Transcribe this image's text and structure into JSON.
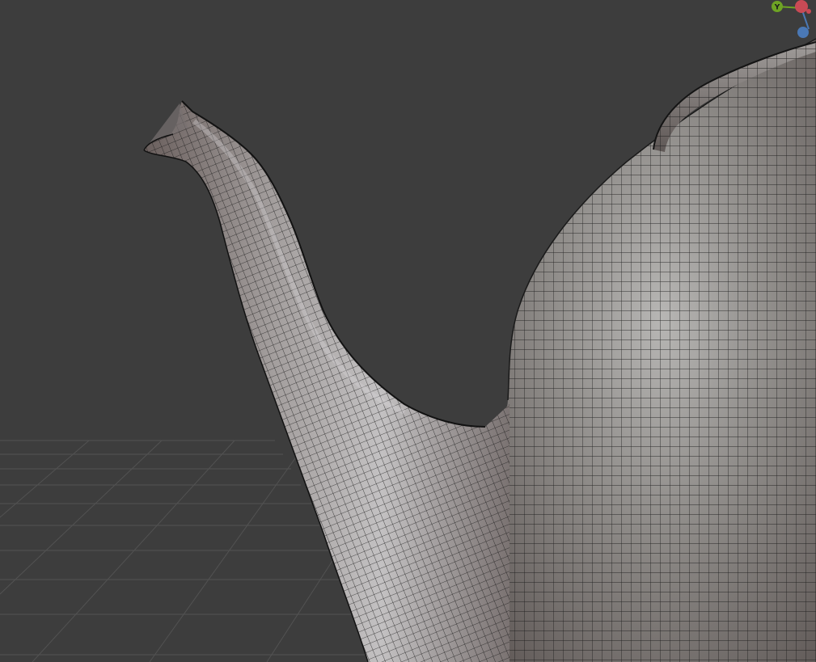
{
  "viewport": {
    "mode": "3D viewport",
    "object": "teapot-mesh",
    "shading": "material-preview-with-wireframe"
  },
  "gizmo": {
    "axes": [
      {
        "id": "y",
        "label": "Y",
        "color": "#6ea324"
      },
      {
        "id": "x",
        "label": "",
        "color": "#c94a55"
      },
      {
        "id": "z",
        "label": "",
        "color": "#4a78b5"
      }
    ]
  },
  "colors": {
    "background": "#3d3d3d",
    "grid": "#545454",
    "mesh_base": "#8f8a88",
    "wire": "#1a1a1a"
  }
}
